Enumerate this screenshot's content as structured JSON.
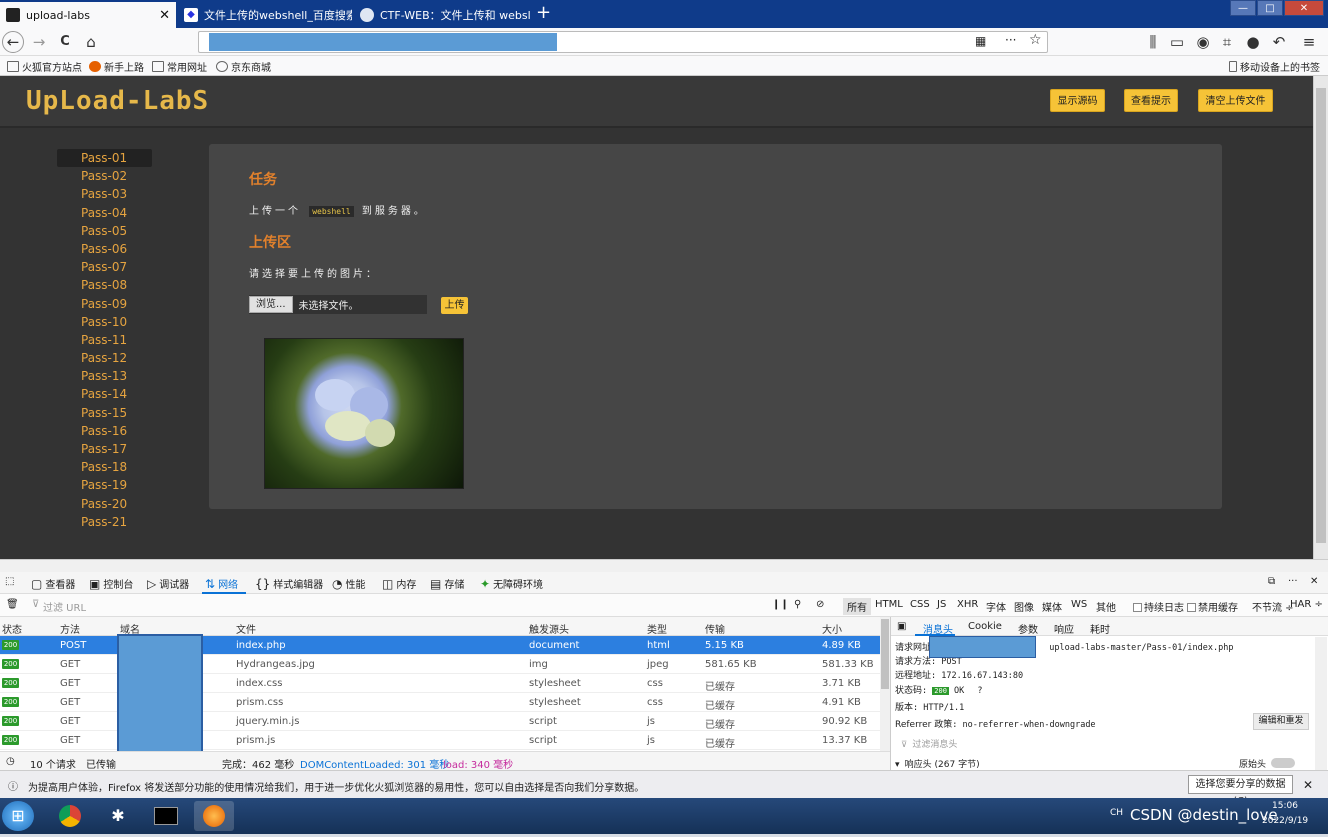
{
  "tabs": [
    {
      "title": "upload-labs",
      "active": true,
      "icon": "site-icon"
    },
    {
      "title": "文件上传的webshell_百度搜索",
      "active": false,
      "icon": "baidu-paw-icon"
    },
    {
      "title": "CTF-WEB：文件上传和 websl",
      "active": false,
      "icon": "globe-icon"
    }
  ],
  "window": {
    "minimize": "—",
    "maximize": "□",
    "close": "✕"
  },
  "nav": {
    "back": "←",
    "forward": "→",
    "reload": "C",
    "home": "⌂",
    "menu": "···",
    "star": "☆",
    "qr": "▦"
  },
  "bookmarks": [
    {
      "label": "火狐官方站点"
    },
    {
      "label": "新手上路"
    },
    {
      "label": "常用网址"
    },
    {
      "label": "京东商城"
    }
  ],
  "mobile_bookmarks": "移动设备上的书签",
  "site": {
    "logo": "UpLoad-LabS",
    "buttons": {
      "source": "显示源码",
      "hint": "查看提示",
      "clear": "清空上传文件"
    },
    "passes": [
      "Pass-01",
      "Pass-02",
      "Pass-03",
      "Pass-04",
      "Pass-05",
      "Pass-06",
      "Pass-07",
      "Pass-08",
      "Pass-09",
      "Pass-10",
      "Pass-11",
      "Pass-12",
      "Pass-13",
      "Pass-14",
      "Pass-15",
      "Pass-16",
      "Pass-17",
      "Pass-18",
      "Pass-19",
      "Pass-20",
      "Pass-21"
    ],
    "task_title": "任务",
    "task_before": "上传一个",
    "task_code": "webshell",
    "task_after": "到服务器。",
    "upload_title": "上传区",
    "upload_prompt": "请选择要上传的图片：",
    "browse": "浏览...",
    "no_file": "未选择文件。",
    "upload_btn": "上传"
  },
  "devtools": {
    "tools": [
      "查看器",
      "控制台",
      "调试器",
      "网络",
      "样式编辑器",
      "性能",
      "内存",
      "存储",
      "无障碍环境"
    ],
    "filter_placeholder": "过滤 URL",
    "types": [
      "所有",
      "HTML",
      "CSS",
      "JS",
      "XHR",
      "字体",
      "图像",
      "媒体",
      "WS",
      "其他"
    ],
    "persist": "持续日志",
    "disable_cache": "禁用缓存",
    "throttle": "不节流 ÷",
    "har": "HAR ÷",
    "columns": [
      "状态",
      "方法",
      "域名",
      "文件",
      "触发源头",
      "类型",
      "传输",
      "大小"
    ],
    "requests": [
      {
        "status": "200",
        "method": "POST",
        "file": "index.php",
        "cause": "document",
        "type": "html",
        "transferred": "5.15 KB",
        "size": "4.89 KB"
      },
      {
        "status": "200",
        "method": "GET",
        "file": "Hydrangeas.jpg",
        "cause": "img",
        "type": "jpeg",
        "transferred": "581.65 KB",
        "size": "581.33 KB"
      },
      {
        "status": "200",
        "method": "GET",
        "file": "index.css",
        "cause": "stylesheet",
        "type": "css",
        "transferred": "已缓存",
        "size": "3.71 KB"
      },
      {
        "status": "200",
        "method": "GET",
        "file": "prism.css",
        "cause": "stylesheet",
        "type": "css",
        "transferred": "已缓存",
        "size": "4.91 KB"
      },
      {
        "status": "200",
        "method": "GET",
        "file": "jquery.min.js",
        "cause": "script",
        "type": "js",
        "transferred": "已缓存",
        "size": "90.92 KB"
      },
      {
        "status": "200",
        "method": "GET",
        "file": "prism.js",
        "cause": "script",
        "type": "js",
        "transferred": "已缓存",
        "size": "13.37 KB"
      }
    ],
    "status": {
      "count": "10 个请求",
      "transferred": "已传输",
      "finish": "完成：462 毫秒",
      "dcl": "DOMContentLoaded: 301 毫秒",
      "load": "load: 340 毫秒"
    },
    "detail_tabs": [
      "消息头",
      "Cookie",
      "参数",
      "响应",
      "耗时"
    ],
    "details": {
      "url_label": "请求网址",
      "url_value": "upload-labs-master/Pass-01/index.php",
      "method_label": "请求方法",
      "method_value": "POST",
      "remote_label": "远程地址",
      "remote_value": "172.16.67.143:80",
      "status_label": "状态码",
      "status_code": "200",
      "status_text": "OK",
      "version_label": "版本",
      "version_value": "HTTP/1.1",
      "referrer_label": "Referrer 政策",
      "referrer_value": "no-referrer-when-downgrade",
      "resend": "编辑和重发",
      "filter_headers": "过滤消息头",
      "response_headers": "响应头 (267 字节)",
      "raw_headers": "原始头"
    }
  },
  "notification": {
    "text": "为提高用户体验，Firefox 将发送部分功能的使用情况给我们，用于进一步优化火狐浏览器的易用性，您可以自由选择是否向我们分享数据。",
    "share_button": "选择您要分享的数据(C)",
    "close": "✕"
  },
  "taskbar": {
    "watermark": "CSDN @destin_love",
    "clock": "15:06",
    "date": "2022/9/19",
    "lang": "CH"
  }
}
